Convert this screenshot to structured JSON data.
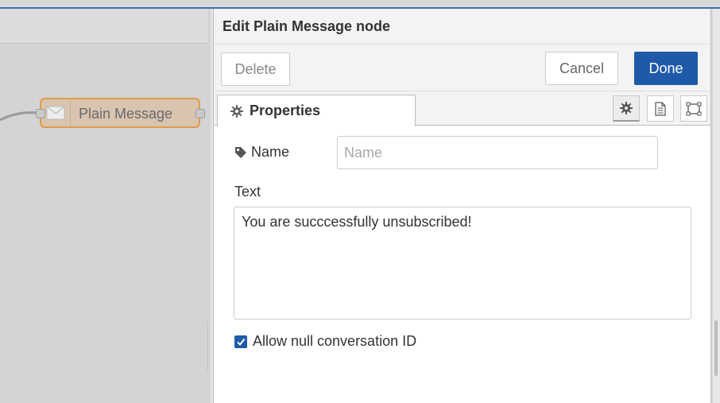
{
  "workspace": {
    "node": {
      "label": "Plain Message",
      "icon": "envelope-icon"
    }
  },
  "tray": {
    "title": "Edit Plain Message node",
    "buttons": {
      "delete": "Delete",
      "cancel": "Cancel",
      "done": "Done"
    },
    "tabs": {
      "properties": "Properties",
      "icons": [
        "gear-icon",
        "description-icon",
        "appearance-icon"
      ]
    },
    "form": {
      "name_label": "Name",
      "name_value": "",
      "name_placeholder": "Name",
      "text_label": "Text",
      "text_value": "You are succcessfully unsubscribed!",
      "checkbox_label": "Allow null conversation ID",
      "checkbox_checked": true
    }
  },
  "colors": {
    "accent": "#1f5aa8",
    "node_fill": "#d9c4b0",
    "node_border": "#e39b4b"
  }
}
